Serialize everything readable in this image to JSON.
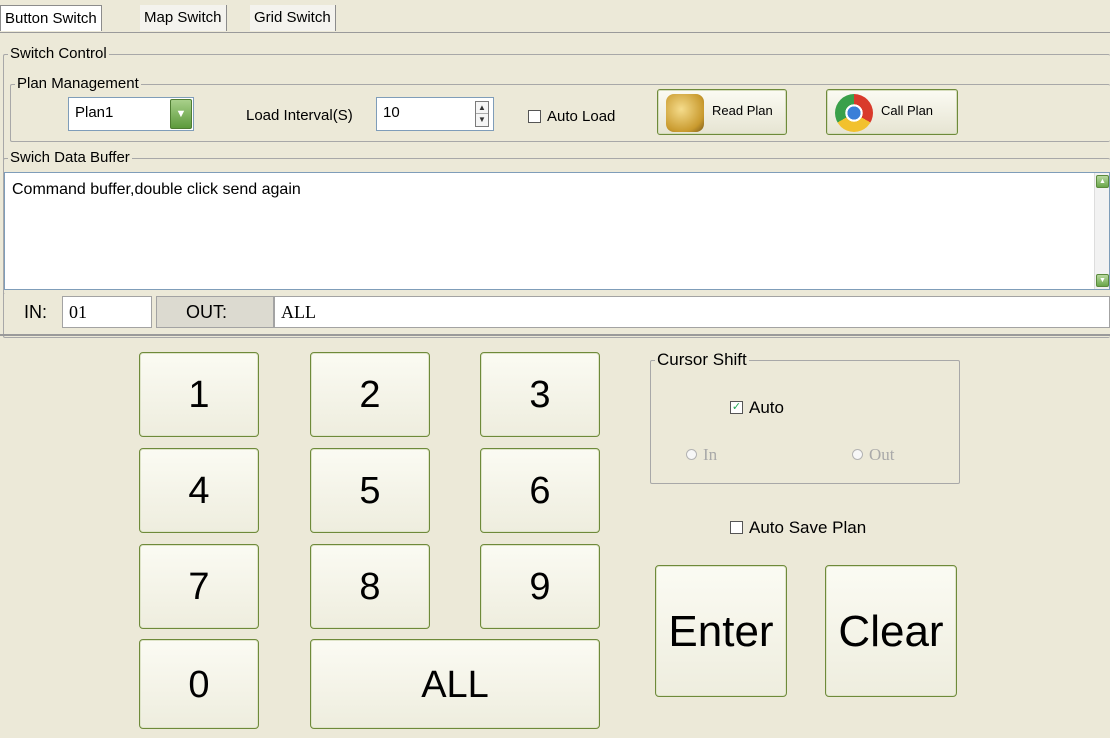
{
  "tabs": [
    "Button Switch",
    "Map Switch",
    "Grid Switch"
  ],
  "switch_control": {
    "title": "Switch Control"
  },
  "plan_management": {
    "title": "Plan Management",
    "plan_select_value": "Plan1",
    "load_interval_label": "Load Interval(S)",
    "load_interval_value": "10",
    "auto_load_label": "Auto Load",
    "read_plan_label": "Read Plan",
    "call_plan_label": "Call Plan"
  },
  "buffer": {
    "title": "Swich Data Buffer",
    "text": "Command buffer,double click send again"
  },
  "io": {
    "in_label": "IN:",
    "in_value": "01",
    "out_label": "OUT:",
    "out_value": "ALL"
  },
  "keypad": [
    "1",
    "2",
    "3",
    "4",
    "5",
    "6",
    "7",
    "8",
    "9",
    "0",
    "ALL"
  ],
  "cursor_shift": {
    "title": "Cursor Shift",
    "auto_label": "Auto",
    "auto_checked": true,
    "in_label": "In",
    "out_label": "Out"
  },
  "auto_save_plan_label": "Auto Save Plan",
  "actions": {
    "enter_label": "Enter",
    "clear_label": "Clear"
  }
}
